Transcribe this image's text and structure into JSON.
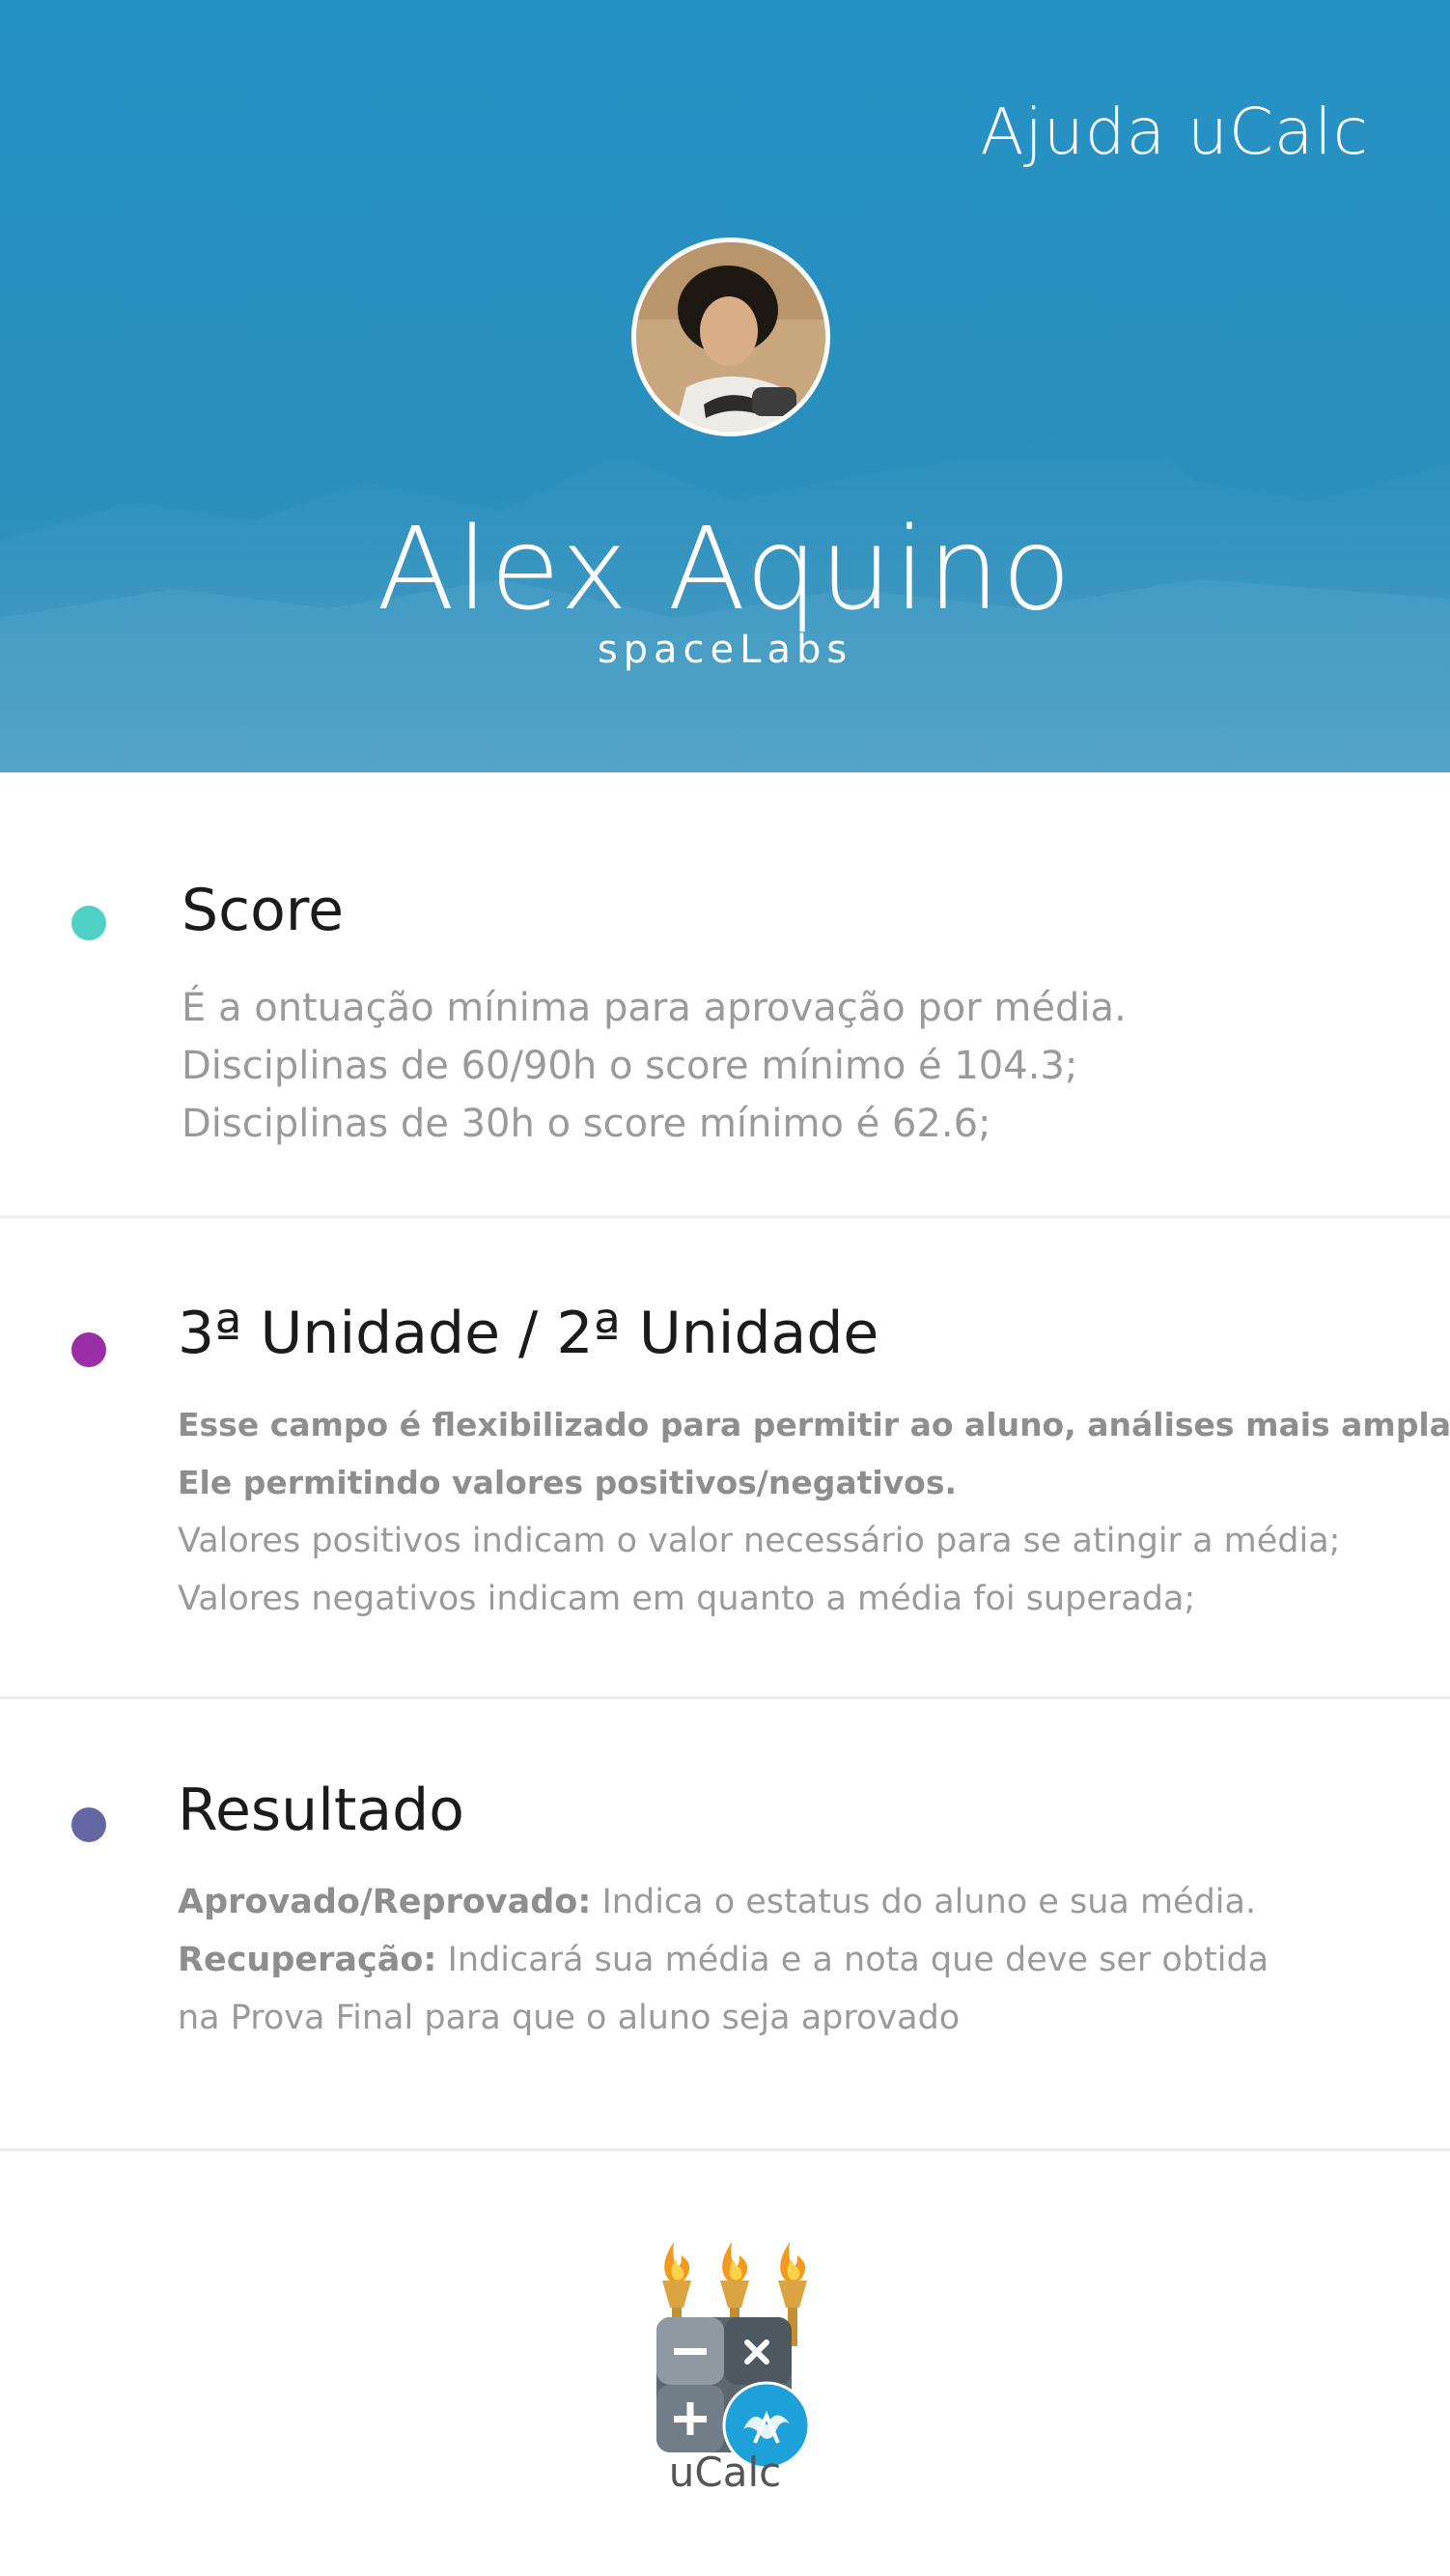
{
  "header": {
    "title": "Ajuda uCalc",
    "user_name": "Alex Aquino",
    "organization": "spaceLabs",
    "background_color": "#2592c4"
  },
  "sections": [
    {
      "title": "Score",
      "dot_color": "#4fd1c5",
      "lines": [
        "É a ontuação mínima para aprovação por média.",
        "Disciplinas de 60/90h o score mínimo é 104.3;",
        "Disciplinas de  30h o score mínimo é 62.6;"
      ]
    },
    {
      "title": "3ª Unidade / 2ª Unidade",
      "dot_color": "#9b2ea6",
      "bold_lines": [
        "Esse campo é flexibilizado para permitir ao aluno, análises mais amplas.",
        "Ele permitindo valores positivos/negativos."
      ],
      "lines": [
        "Valores positivos indicam o valor necessário para se atingir a média;",
        "Valores negativos indicam em quanto a média foi superada;"
      ]
    },
    {
      "title": "Resultado",
      "dot_color": "#6467a3",
      "items": [
        {
          "label": "Aprovado/Reprovado:",
          "text": " Indica o estatus do aluno e sua média."
        },
        {
          "label": "Recuperação:",
          "text": " Indicará sua média e a nota que deve ser obtida"
        }
      ],
      "continuation": "na Prova Final para que o aluno seja aprovado"
    }
  ],
  "footer": {
    "app_name": "uCalc",
    "logo_icons": [
      "torch-icon",
      "calculator-icon",
      "minus-icon",
      "multiply-icon",
      "plus-icon",
      "ufba-emblem-icon"
    ]
  }
}
